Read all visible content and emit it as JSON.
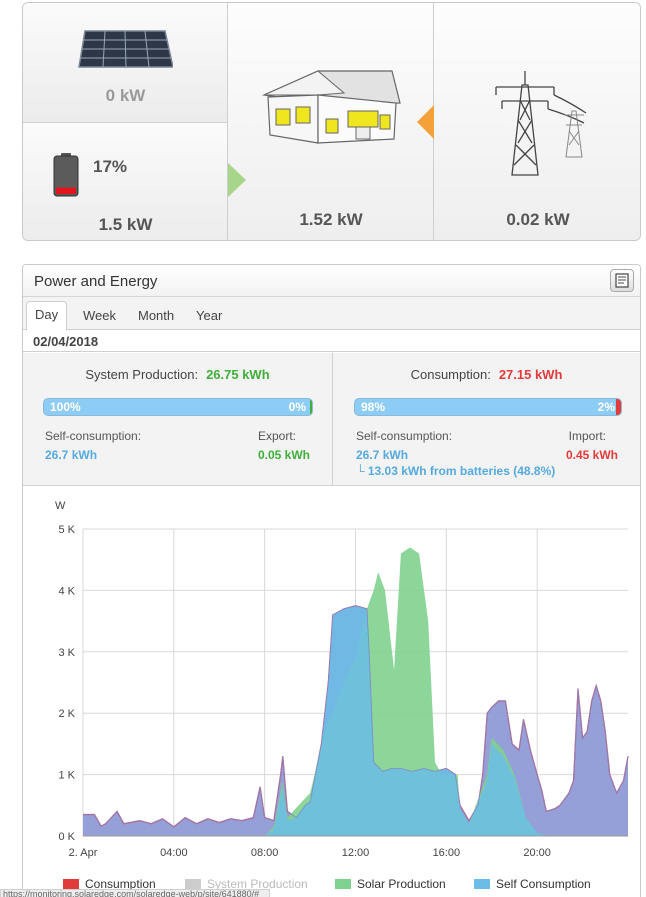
{
  "flow": {
    "pv_power": "0 kW",
    "battery_percent": "17%",
    "battery_power": "1.5 kW",
    "house_power": "1.52 kW",
    "grid_power": "0.02 kW",
    "battery_level": 0.17
  },
  "panel": {
    "title": "Power and Energy",
    "tabs": [
      "Day",
      "Week",
      "Month",
      "Year"
    ],
    "active_tab": "Day",
    "date": "02/04/2018"
  },
  "production": {
    "label": "System Production:",
    "value": "26.75 kWh",
    "bar_left": "100%",
    "bar_right": "0%",
    "self_label": "Self-consumption:",
    "self_value": "26.7 kWh",
    "export_label": "Export:",
    "export_value": "0.05 kWh"
  },
  "consumption": {
    "label": "Consumption:",
    "value": "27.15 kWh",
    "bar_left": "98%",
    "bar_right": "2%",
    "self_label": "Self-consumption:",
    "self_value": "26.7 kWh",
    "batteries_note": "└ 13.03 kWh from batteries (48.8%)",
    "import_label": "Import:",
    "import_value": "0.45 kWh"
  },
  "colors": {
    "consumption": "#e23b3b",
    "system_production": "#cccccc",
    "solar_production": "#7fd18f",
    "self_consumption": "#6bbde8",
    "consumption_fill": "#8f9ad6"
  },
  "chart_data": {
    "type": "area",
    "ylabel": "W",
    "y_ticks": [
      "0 K",
      "1 K",
      "2 K",
      "3 K",
      "4 K",
      "5 K"
    ],
    "ylim": [
      0,
      5000
    ],
    "x_ticks": [
      "2. Apr",
      "04:00",
      "08:00",
      "12:00",
      "16:00",
      "20:00"
    ],
    "xlim": [
      0,
      24
    ],
    "grid": true,
    "legend": [
      {
        "name": "Consumption",
        "color": "#e23b3b",
        "dimmed": false
      },
      {
        "name": "System Production",
        "color": "#cccccc",
        "dimmed": true
      },
      {
        "name": "Solar Production",
        "color": "#7fd18f",
        "dimmed": false
      },
      {
        "name": "Self Consumption",
        "color": "#6bbde8",
        "dimmed": false
      }
    ],
    "series": [
      {
        "name": "Consumption",
        "points": [
          [
            0,
            350
          ],
          [
            0.5,
            350
          ],
          [
            0.8,
            160
          ],
          [
            1,
            200
          ],
          [
            1.5,
            400
          ],
          [
            1.8,
            200
          ],
          [
            2.5,
            250
          ],
          [
            3,
            200
          ],
          [
            3.5,
            280
          ],
          [
            4,
            150
          ],
          [
            4.5,
            300
          ],
          [
            5,
            200
          ],
          [
            5.5,
            280
          ],
          [
            6,
            220
          ],
          [
            6.5,
            280
          ],
          [
            7,
            250
          ],
          [
            7.5,
            300
          ],
          [
            7.8,
            800
          ],
          [
            8,
            300
          ],
          [
            8.4,
            250
          ],
          [
            8.7,
            1000
          ],
          [
            8.8,
            1300
          ],
          [
            9,
            400
          ],
          [
            9.4,
            300
          ],
          [
            9.8,
            500
          ],
          [
            10,
            550
          ],
          [
            10.5,
            1500
          ],
          [
            10.8,
            2500
          ],
          [
            11,
            3600
          ],
          [
            11.5,
            3700
          ],
          [
            12,
            3750
          ],
          [
            12.5,
            3700
          ],
          [
            12.6,
            3000
          ],
          [
            12.8,
            1200
          ],
          [
            13.2,
            1050
          ],
          [
            13.6,
            1100
          ],
          [
            14,
            1100
          ],
          [
            14.5,
            1050
          ],
          [
            15,
            1100
          ],
          [
            15.5,
            1050
          ],
          [
            16,
            1100
          ],
          [
            16.4,
            1000
          ],
          [
            16.6,
            500
          ],
          [
            17,
            250
          ],
          [
            17.4,
            500
          ],
          [
            17.6,
            1000
          ],
          [
            17.8,
            2000
          ],
          [
            18,
            2100
          ],
          [
            18.3,
            2200
          ],
          [
            18.6,
            2200
          ],
          [
            18.9,
            1500
          ],
          [
            19.2,
            1400
          ],
          [
            19.4,
            1900
          ],
          [
            19.7,
            1400
          ],
          [
            20,
            1000
          ],
          [
            20.2,
            750
          ],
          [
            20.4,
            400
          ],
          [
            20.8,
            450
          ],
          [
            21,
            500
          ],
          [
            21.4,
            700
          ],
          [
            21.6,
            900
          ],
          [
            21.8,
            2400
          ],
          [
            22,
            1600
          ],
          [
            22.2,
            1700
          ],
          [
            22.4,
            2200
          ],
          [
            22.6,
            2450
          ],
          [
            22.8,
            2200
          ],
          [
            23,
            1700
          ],
          [
            23.2,
            1000
          ],
          [
            23.5,
            700
          ],
          [
            23.8,
            900
          ],
          [
            24,
            1300
          ]
        ]
      },
      {
        "name": "Solar Production",
        "points": [
          [
            0,
            0
          ],
          [
            8,
            0
          ],
          [
            8.4,
            150
          ],
          [
            8.8,
            900
          ],
          [
            9,
            300
          ],
          [
            9.5,
            500
          ],
          [
            10,
            700
          ],
          [
            10.2,
            1000
          ],
          [
            10.6,
            1700
          ],
          [
            11,
            2000
          ],
          [
            11.5,
            2500
          ],
          [
            12,
            2900
          ],
          [
            12.4,
            3600
          ],
          [
            12.8,
            4000
          ],
          [
            13,
            4300
          ],
          [
            13.3,
            4000
          ],
          [
            13.7,
            2700
          ],
          [
            14,
            4600
          ],
          [
            14.4,
            4700
          ],
          [
            14.8,
            4600
          ],
          [
            15.2,
            3500
          ],
          [
            15.5,
            1200
          ],
          [
            15.8,
            1000
          ],
          [
            16,
            1000
          ],
          [
            16.5,
            1000
          ],
          [
            16.6,
            400
          ],
          [
            17,
            200
          ],
          [
            17.8,
            1000
          ],
          [
            18,
            1600
          ],
          [
            18.5,
            1400
          ],
          [
            19,
            1000
          ],
          [
            19.5,
            300
          ],
          [
            20,
            50
          ],
          [
            20.5,
            0
          ],
          [
            24,
            0
          ]
        ]
      },
      {
        "name": "Self Consumption",
        "points": [
          [
            0,
            0
          ],
          [
            8,
            0
          ],
          [
            8.4,
            100
          ],
          [
            8.8,
            800
          ],
          [
            9,
            250
          ],
          [
            9.4,
            300
          ],
          [
            9.8,
            500
          ],
          [
            10,
            550
          ],
          [
            10.5,
            1500
          ],
          [
            10.8,
            2500
          ],
          [
            11,
            3600
          ],
          [
            11.5,
            3700
          ],
          [
            12,
            3750
          ],
          [
            12.5,
            3700
          ],
          [
            12.6,
            3000
          ],
          [
            12.8,
            1200
          ],
          [
            13.2,
            1050
          ],
          [
            13.6,
            1100
          ],
          [
            14,
            1100
          ],
          [
            14.5,
            1050
          ],
          [
            15,
            1100
          ],
          [
            15.5,
            1050
          ],
          [
            16,
            1100
          ],
          [
            16.4,
            1000
          ],
          [
            16.6,
            450
          ],
          [
            17,
            200
          ],
          [
            17.8,
            900
          ],
          [
            18,
            1500
          ],
          [
            18.5,
            1300
          ],
          [
            19,
            950
          ],
          [
            19.5,
            300
          ],
          [
            20,
            50
          ],
          [
            20.5,
            0
          ],
          [
            24,
            0
          ]
        ]
      }
    ]
  },
  "status_bar": "https://monitoring.solaredge.com/solaredge-web/p/site/641880/#"
}
